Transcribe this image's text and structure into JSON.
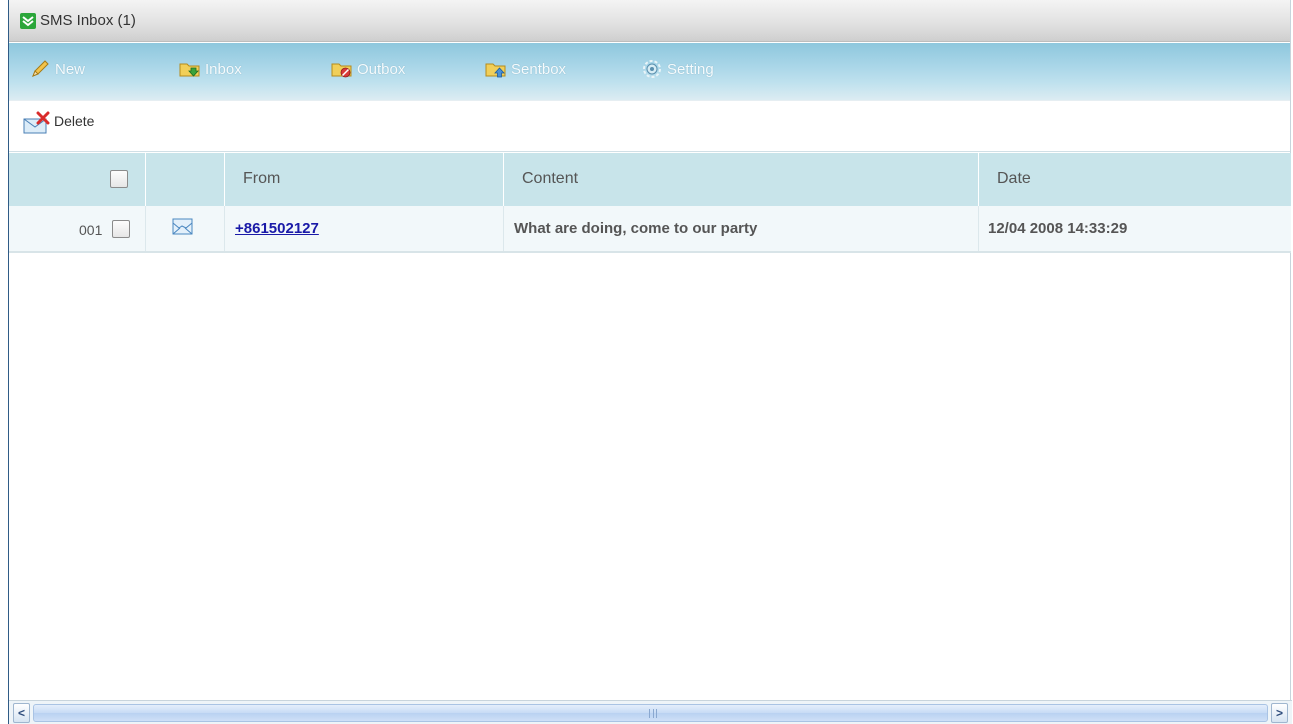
{
  "window": {
    "title": "SMS Inbox (1)"
  },
  "nav": {
    "items": [
      {
        "label": "New",
        "icon": "pencil-icon"
      },
      {
        "label": "Inbox",
        "icon": "inbox-folder-icon"
      },
      {
        "label": "Outbox",
        "icon": "outbox-folder-icon"
      },
      {
        "label": "Sentbox",
        "icon": "sentbox-folder-icon"
      },
      {
        "label": "Setting",
        "icon": "gear-icon"
      }
    ]
  },
  "toolbar": {
    "delete_label": "Delete",
    "delete_icon": "delete-mail-icon"
  },
  "table": {
    "columns": [
      "",
      "",
      "From",
      "Content",
      "Date"
    ],
    "rows": [
      {
        "index": "001",
        "icon": "envelope-icon",
        "from": "+861502127",
        "content": "What are doing, come to our party",
        "date": "12/04 2008 14:33:29",
        "checked": false
      }
    ]
  },
  "colors": {
    "nav_bar": "#a9d6e8",
    "header_row": "#c8e4ea",
    "link": "#1a1aa8",
    "title_icon": "#2ba63a"
  }
}
